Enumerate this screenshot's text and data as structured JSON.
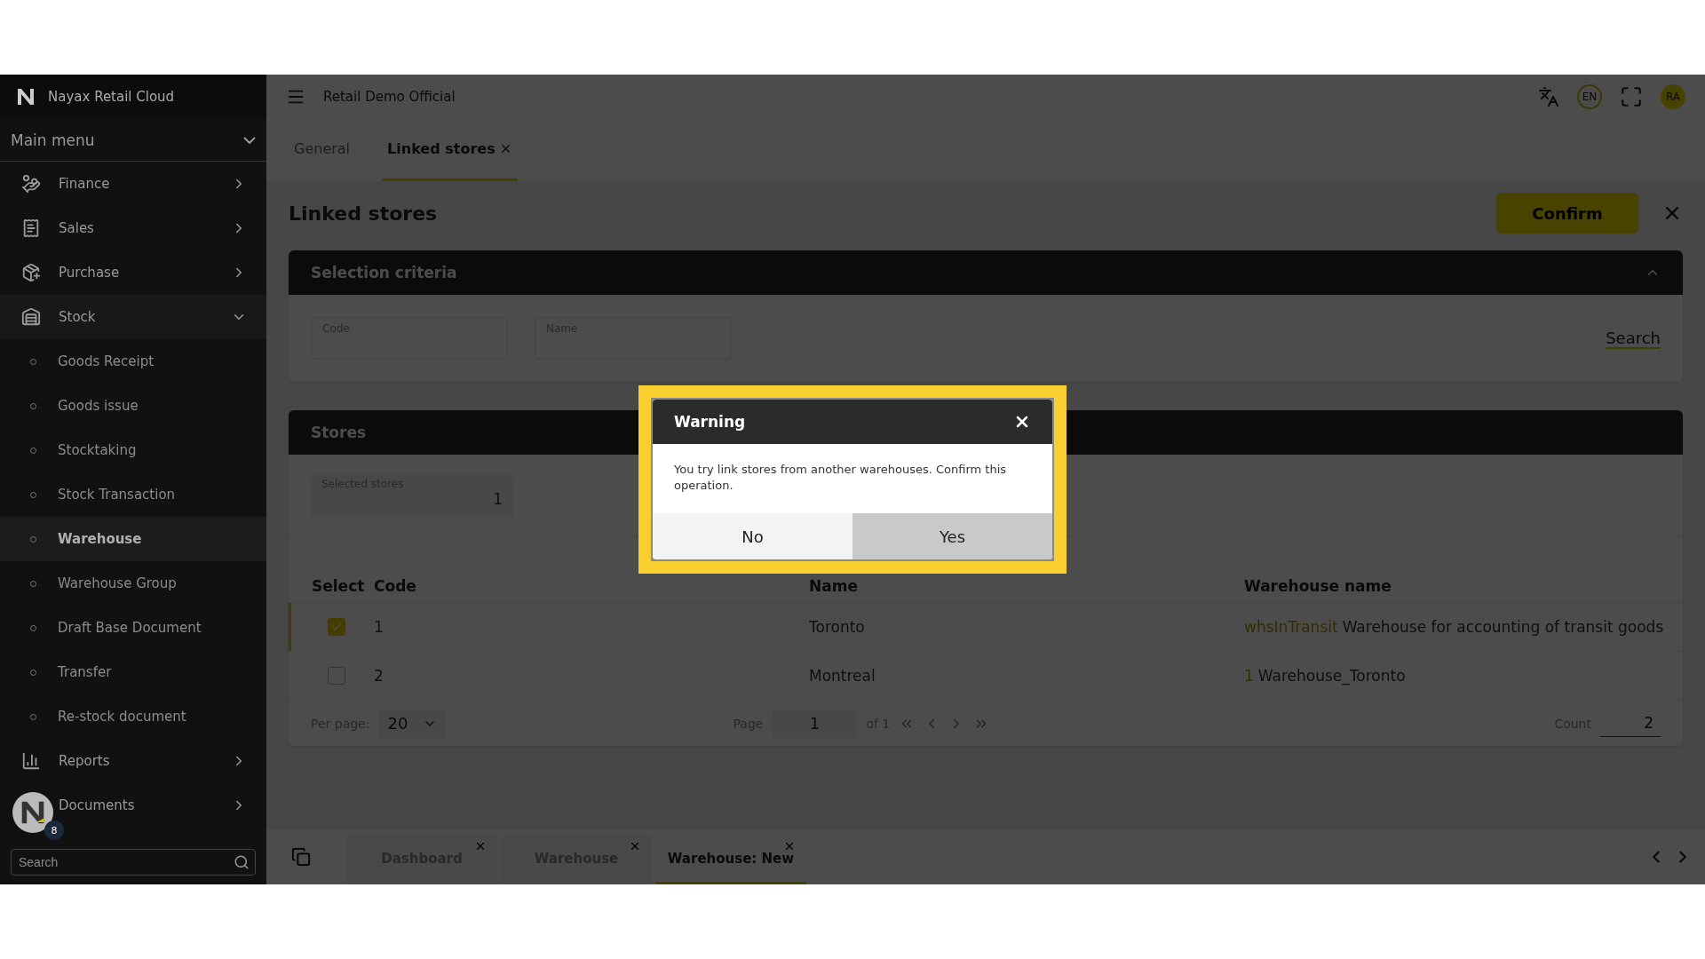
{
  "app": {
    "brand": "Nayax Retail Cloud",
    "company": "Retail Demo Official",
    "language": "EN",
    "user_initials": "RA"
  },
  "sidebar": {
    "menu_title": "Main menu",
    "items": [
      {
        "label": "Finance",
        "expanded": false
      },
      {
        "label": "Sales",
        "expanded": false
      },
      {
        "label": "Purchase",
        "expanded": false
      },
      {
        "label": "Stock",
        "expanded": true,
        "children": [
          {
            "label": "Goods Receipt",
            "selected": false
          },
          {
            "label": "Goods issue",
            "selected": false
          },
          {
            "label": "Stocktaking",
            "selected": false
          },
          {
            "label": "Stock Transaction",
            "selected": false
          },
          {
            "label": "Warehouse",
            "selected": true
          },
          {
            "label": "Warehouse Group",
            "selected": false
          },
          {
            "label": "Draft Base Document",
            "selected": false
          },
          {
            "label": "Transfer",
            "selected": false
          },
          {
            "label": "Re-stock document",
            "selected": false
          }
        ]
      },
      {
        "label": "Reports",
        "expanded": false
      },
      {
        "label": "Documents",
        "expanded": false
      }
    ],
    "search_placeholder": "Search",
    "badge_count": "8"
  },
  "tabs": [
    {
      "label": "General",
      "selected": false,
      "closable": false
    },
    {
      "label": "Linked stores",
      "selected": true,
      "closable": true
    }
  ],
  "page": {
    "title": "Linked stores",
    "confirm_button": "Confirm"
  },
  "selection_criteria": {
    "title": "Selection criteria",
    "fields": [
      {
        "label": "Code"
      },
      {
        "label": "Name"
      }
    ],
    "search_button": "Search"
  },
  "stores": {
    "title": "Stores",
    "selected_stores": {
      "label": "Selected stores",
      "value": "1"
    },
    "columns": [
      "Select",
      "Code",
      "Name",
      "Warehouse name"
    ],
    "rows": [
      {
        "checked": true,
        "code": "1",
        "name": "Toronto",
        "warehouse_code": "whsInTransit",
        "warehouse_name": "Warehouse for accounting of transit goods"
      },
      {
        "checked": false,
        "code": "2",
        "name": "Montreal",
        "warehouse_code": "1",
        "warehouse_name": "Warehouse_Toronto"
      }
    ],
    "footer": {
      "per_page_label": "Per page:",
      "per_page": "20",
      "page_label": "Page",
      "page": "1",
      "of_label": "of 1",
      "count_label": "Count",
      "count": "2"
    }
  },
  "bottom_tabs": [
    {
      "label": "Dashboard",
      "selected": false
    },
    {
      "label": "Warehouse",
      "selected": false
    },
    {
      "label": "Warehouse: New",
      "selected": true
    }
  ],
  "dialog": {
    "title": "Warning",
    "message": "You try link stores from another warehouses. Confirm this operation.",
    "buttons": [
      {
        "label": "No",
        "kind": "secondary"
      },
      {
        "label": "Yes",
        "kind": "primary"
      }
    ]
  }
}
